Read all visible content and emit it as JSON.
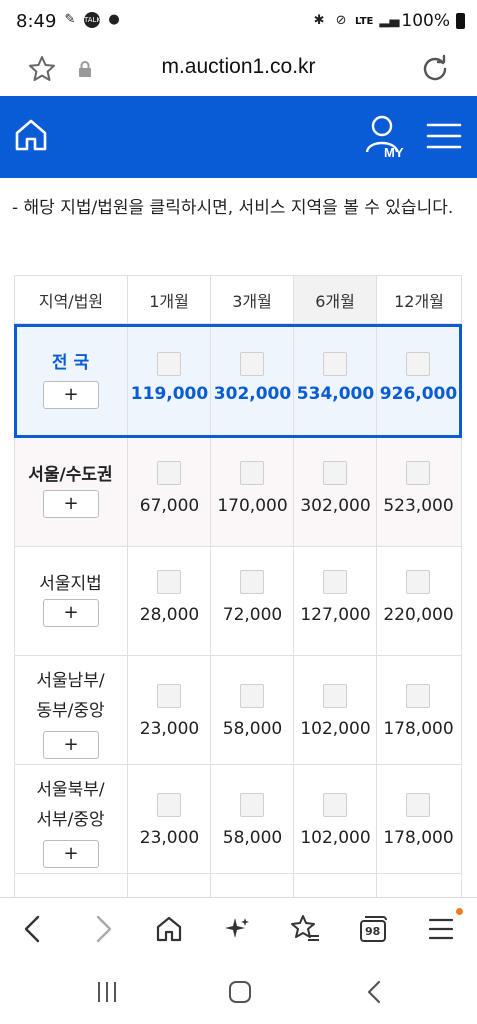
{
  "status_bar": {
    "time": "8:49",
    "battery": "100%",
    "network": "LTE",
    "icons": [
      "notification-icon",
      "talk-icon",
      "chat-icon",
      "bluetooth-icon",
      "dnd-icon",
      "signal-icon",
      "battery-icon"
    ]
  },
  "browser": {
    "url": "m.auction1.co.kr"
  },
  "header": {
    "my_label": "MY",
    "accent_color": "#0a5cd6"
  },
  "notice": "- 해당 지법/법원을 클릭하시면, 서비스 지역을 볼 수 있습니다.",
  "table": {
    "headers": [
      "지역/법원",
      "1개월",
      "3개월",
      "6개월",
      "12개월"
    ],
    "plus_label": "+",
    "rows": [
      {
        "name": "전 국",
        "name2": "",
        "prices": [
          "119,000",
          "302,000",
          "534,000",
          "926,000"
        ]
      },
      {
        "name": "서울/수도권",
        "name2": "",
        "prices": [
          "67,000",
          "170,000",
          "302,000",
          "523,000"
        ]
      },
      {
        "name": "서울지법",
        "name2": "",
        "prices": [
          "28,000",
          "72,000",
          "127,000",
          "220,000"
        ]
      },
      {
        "name": "서울남부/",
        "name2": "동부/중앙",
        "prices": [
          "23,000",
          "58,000",
          "102,000",
          "178,000"
        ]
      },
      {
        "name": "서울북부/",
        "name2": "서부/중앙",
        "prices": [
          "23,000",
          "58,000",
          "102,000",
          "178,000"
        ]
      }
    ]
  },
  "toolbar": {
    "tabs_count": "98"
  }
}
